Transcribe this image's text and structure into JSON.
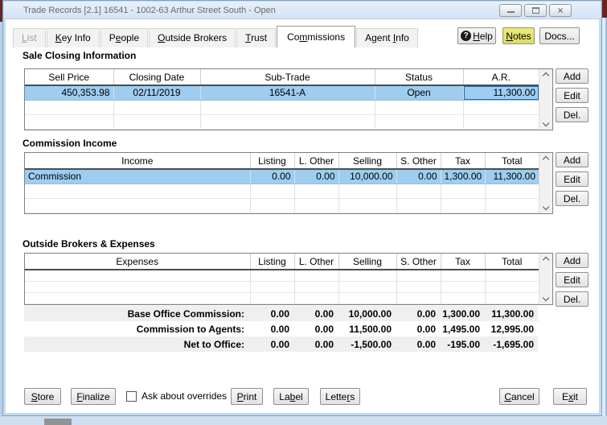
{
  "window": {
    "title": "Trade Records [2.1] 16541 - 1002-63 Arthur Street South - Open",
    "close_glyph": "×"
  },
  "tabs": [
    {
      "pre": "",
      "accel": "L",
      "post": "ist"
    },
    {
      "pre": "",
      "accel": "K",
      "post": "ey Info"
    },
    {
      "pre": "P",
      "accel": "e",
      "post": "ople"
    },
    {
      "pre": "",
      "accel": "O",
      "post": "utside Brokers"
    },
    {
      "pre": "",
      "accel": "T",
      "post": "rust"
    },
    {
      "pre": "Co",
      "accel": "m",
      "post": "missions"
    },
    {
      "pre": "Agent ",
      "accel": "I",
      "post": "nfo"
    }
  ],
  "toolbar": {
    "help": {
      "icon": "?",
      "pre": "",
      "accel": "H",
      "post": "elp"
    },
    "notes": {
      "pre": "",
      "accel": "N",
      "post": "otes"
    },
    "docs": {
      "label": "Docs..."
    }
  },
  "sale_closing": {
    "title": "Sale Closing Information",
    "headers": [
      "Sell Price",
      "Closing Date",
      "Sub-Trade",
      "Status",
      "A.R."
    ],
    "row": {
      "sell_price": "450,353.98",
      "closing_date": "02/11/2019",
      "sub_trade": "16541-A",
      "status": "Open",
      "ar": "11,300.00"
    },
    "buttons": [
      "Add",
      "Edit",
      "Del."
    ]
  },
  "commission_income": {
    "title": "Commission Income",
    "headers": [
      "Income",
      "Listing",
      "L. Other",
      "Selling",
      "S. Other",
      "Tax",
      "Total"
    ],
    "row": {
      "income": "Commission",
      "listing": "0.00",
      "l_other": "0.00",
      "selling": "10,000.00",
      "s_other": "0.00",
      "tax": "1,300.00",
      "total": "11,300.00"
    },
    "buttons": [
      "Add",
      "Edit",
      "Del."
    ]
  },
  "outside_brokers": {
    "title": "Outside Brokers & Expenses",
    "headers": [
      "Expenses",
      "Listing",
      "L. Other",
      "Selling",
      "S. Other",
      "Tax",
      "Total"
    ],
    "buttons": [
      "Add",
      "Edit",
      "Del."
    ]
  },
  "totals": {
    "rows": [
      {
        "label": "Base Office Commission:",
        "values": [
          "0.00",
          "0.00",
          "10,000.00",
          "0.00",
          "1,300.00",
          "11,300.00"
        ]
      },
      {
        "label": "Commission to Agents:",
        "values": [
          "0.00",
          "0.00",
          "11,500.00",
          "0.00",
          "1,495.00",
          "12,995.00"
        ]
      },
      {
        "label": "Net to Office:",
        "values": [
          "0.00",
          "0.00",
          "-1,500.00",
          "0.00",
          "-195.00",
          "-1,695.00"
        ]
      }
    ]
  },
  "footer": {
    "store": {
      "pre": "",
      "accel": "S",
      "post": "tore"
    },
    "finalize": {
      "pre": "",
      "accel": "F",
      "post": "inalize"
    },
    "overrides_label": "Ask about overrides",
    "overrides_checked": false,
    "print": {
      "pre": "",
      "accel": "P",
      "post": "rint"
    },
    "label": {
      "pre": "La",
      "accel": "b",
      "post": "el"
    },
    "letters": {
      "pre": "Lette",
      "accel": "r",
      "post": "s"
    },
    "cancel": {
      "pre": "",
      "accel": "C",
      "post": "ancel"
    },
    "exit": {
      "pre": "E",
      "accel": "x",
      "post": "it"
    }
  },
  "colors": {
    "selection": "#9ecdf0",
    "notes_bg": "#e3e26b",
    "titlebar": "#d8e6f5",
    "parent_accent": "#6e2220"
  }
}
